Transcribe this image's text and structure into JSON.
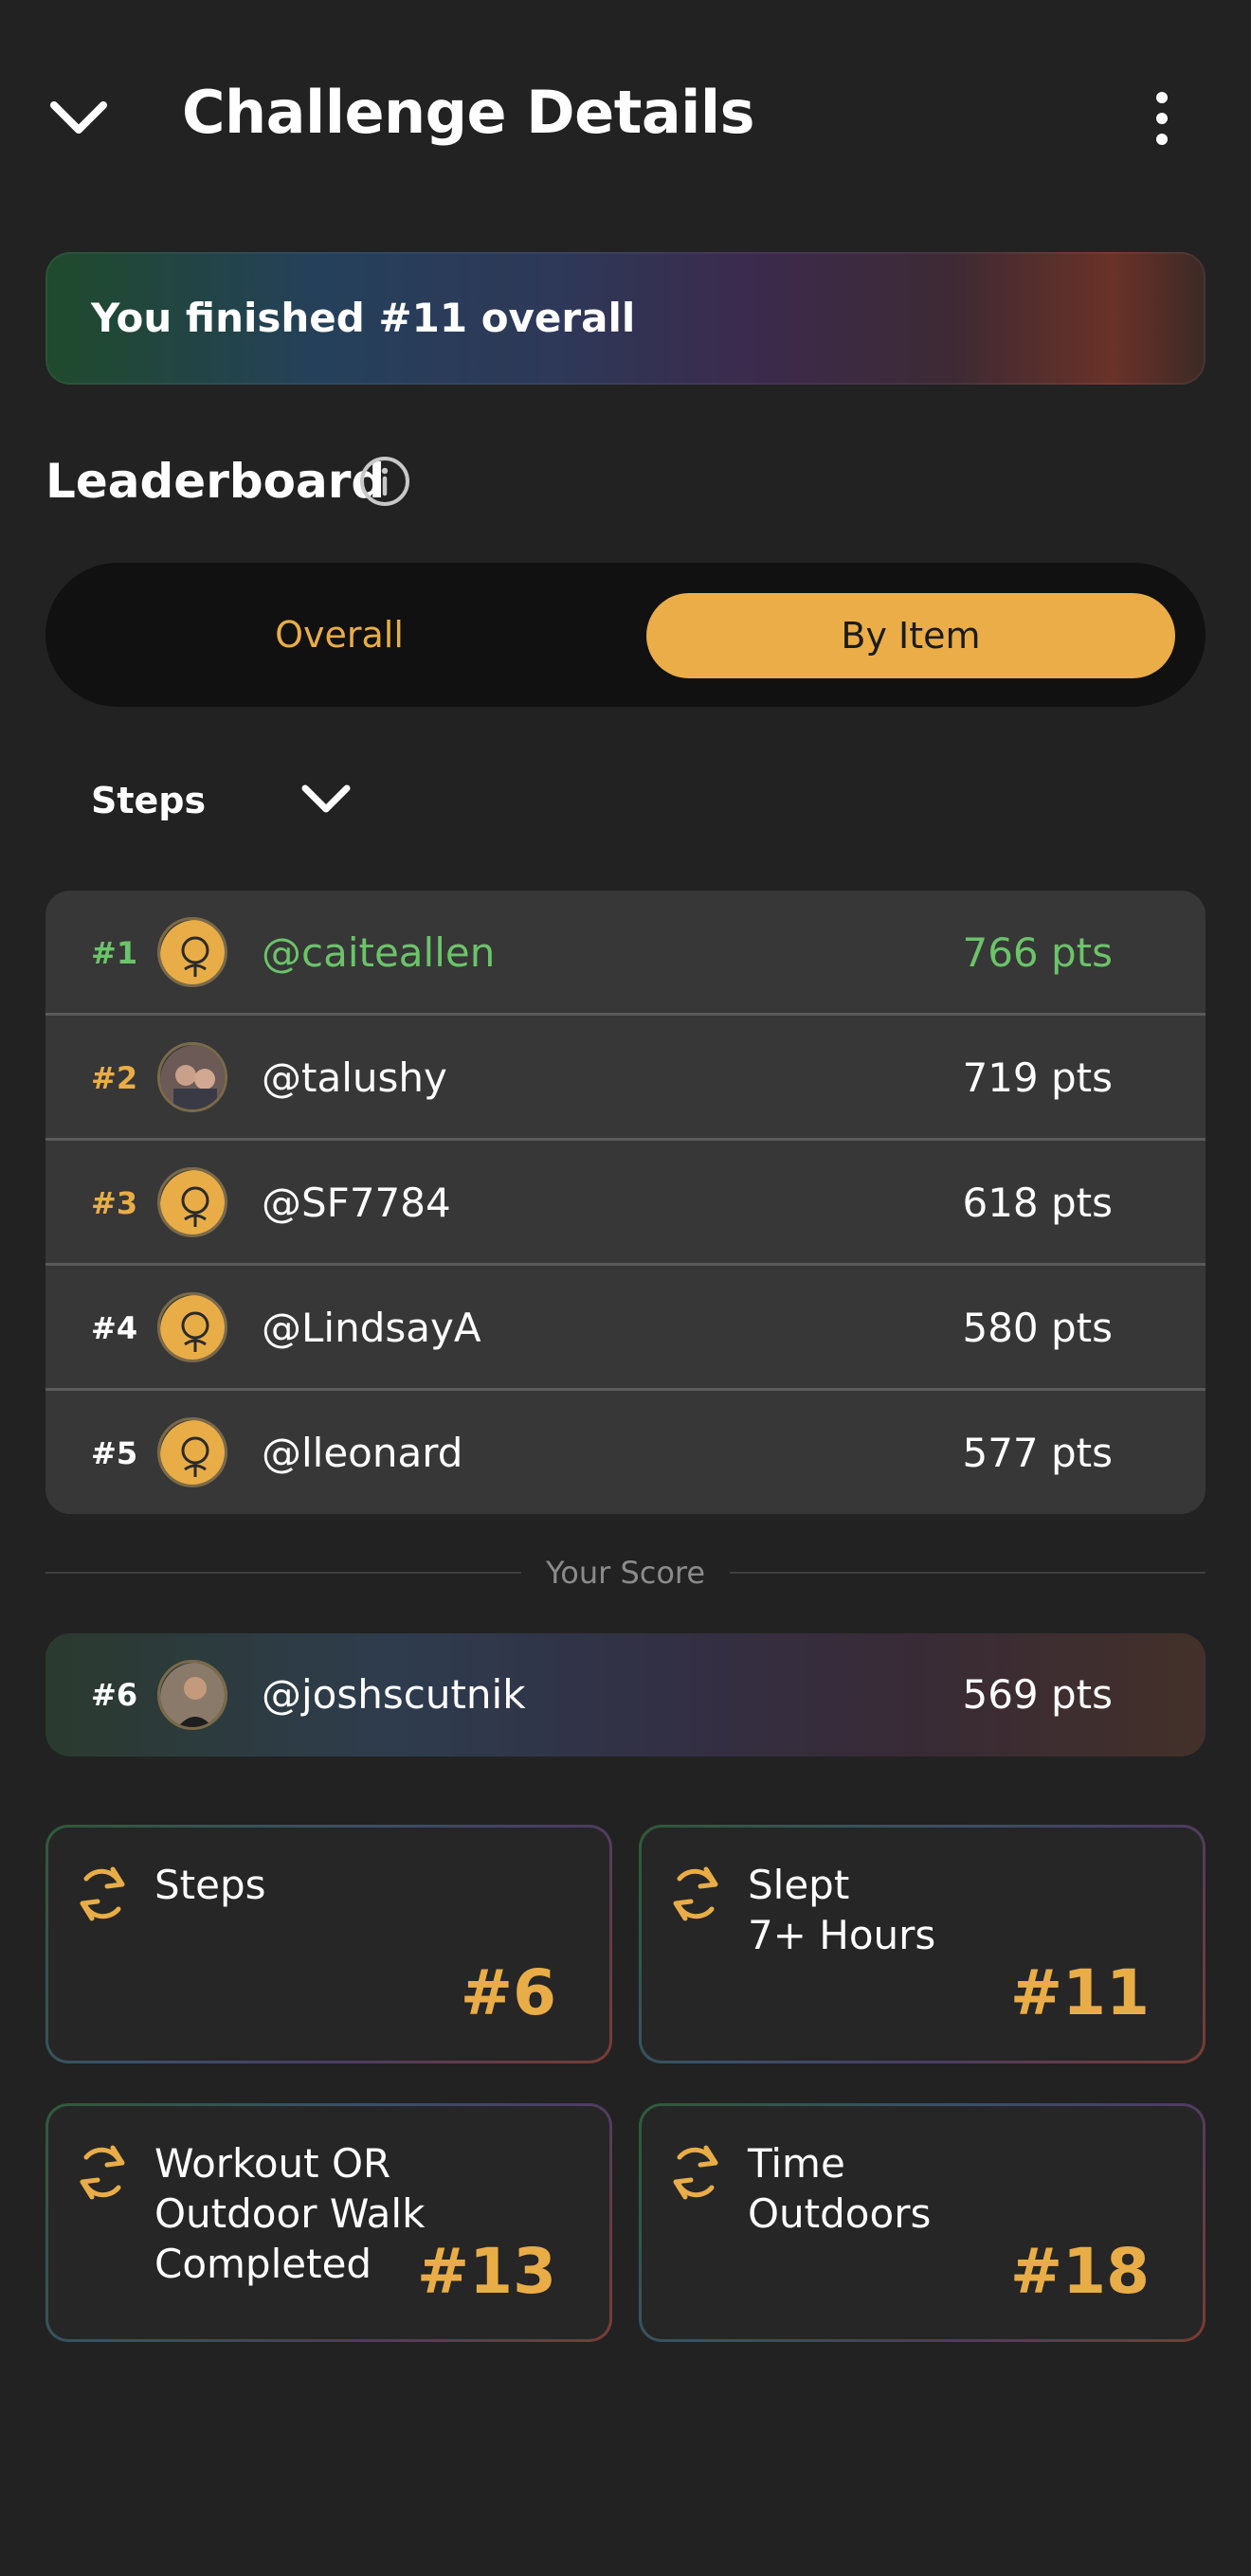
{
  "header": {
    "title": "Challenge Details",
    "back_icon": "chevron-down-icon",
    "more_icon": "more-vertical-icon"
  },
  "banner": {
    "text": "You finished #11 overall"
  },
  "leaderboard": {
    "title": "Leaderboard",
    "info_icon": "info-icon",
    "tabs": {
      "overall": "Overall",
      "by_item": "By Item",
      "selected": "By Item"
    },
    "filter": {
      "label": "Steps"
    },
    "rows": [
      {
        "rank": "#1",
        "user": "@caiteallen",
        "points": "766 pts"
      },
      {
        "rank": "#2",
        "user": "@talushy",
        "points": "719 pts"
      },
      {
        "rank": "#3",
        "user": "@SF7784",
        "points": "618 pts"
      },
      {
        "rank": "#4",
        "user": "@LindsayA",
        "points": "580 pts"
      },
      {
        "rank": "#5",
        "user": "@lleonard",
        "points": "577 pts"
      }
    ],
    "your_score_label": "Your Score",
    "your_score": {
      "rank": "#6",
      "user": "@joshscutnik",
      "points": "569 pts"
    }
  },
  "cards": [
    {
      "label": "Steps",
      "rank": "#6"
    },
    {
      "label": "Slept\n7+ Hours",
      "rank": "#11"
    },
    {
      "label": "Workout OR\nOutdoor Walk\nCompleted",
      "rank": "#13"
    },
    {
      "label": "Time\nOutdoors",
      "rank": "#18"
    }
  ],
  "colors": {
    "accent": "#ebad48",
    "leader_green": "#6cc36a",
    "background": "#222222"
  }
}
